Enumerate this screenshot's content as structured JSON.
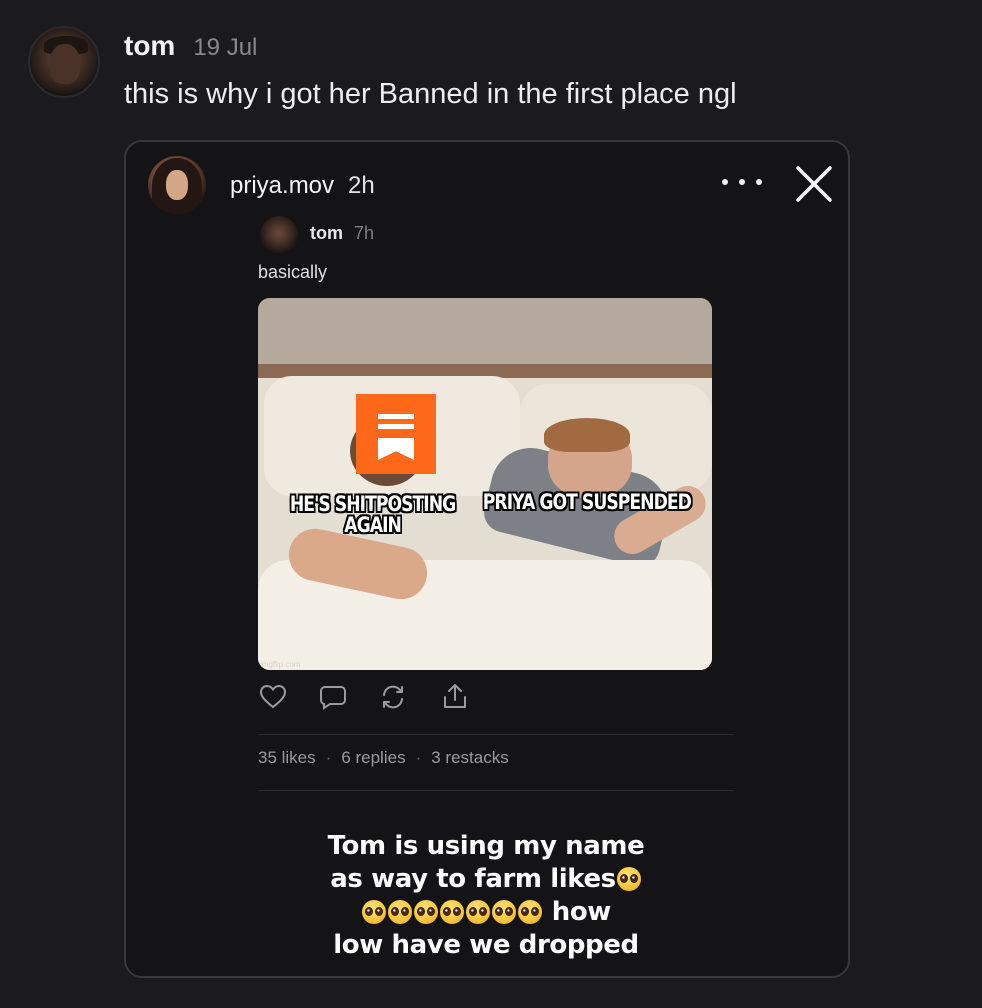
{
  "post": {
    "author": "tom",
    "time": "19 Jul",
    "text": "this is why i got her Banned in the first place ngl"
  },
  "story": {
    "username": "priya.mov",
    "time": "2h",
    "more_icon": "more-horizontal-icon",
    "close_icon": "close-icon",
    "note": {
      "author": "tom",
      "time": "7h",
      "text": "basically",
      "meme": {
        "caption_left": "HE'S SHITPOSTING AGAIN",
        "caption_right": "PRIYA GOT SUSPENDED",
        "watermark": "imgflip.com",
        "logo_icon": "substack-logo-icon"
      },
      "actions": [
        "heart-icon",
        "comment-icon",
        "restack-icon",
        "share-icon"
      ],
      "stats": {
        "likes": "35 likes",
        "replies": "6 replies",
        "restacks": "3 restacks"
      }
    },
    "overlay": {
      "line1": "Tom is using my name",
      "line2": "as way to farm likes",
      "line3_suffix": "how",
      "line4": "low have we dropped",
      "emoji_icon": "pleading-face-icon",
      "emoji_count_line2": 1,
      "emoji_count_line3": 7
    }
  },
  "colors": {
    "background": "#1b1b1d",
    "card_border": "#38383b",
    "substack_orange": "#ff6719",
    "muted_text": "#8a8a8e"
  }
}
